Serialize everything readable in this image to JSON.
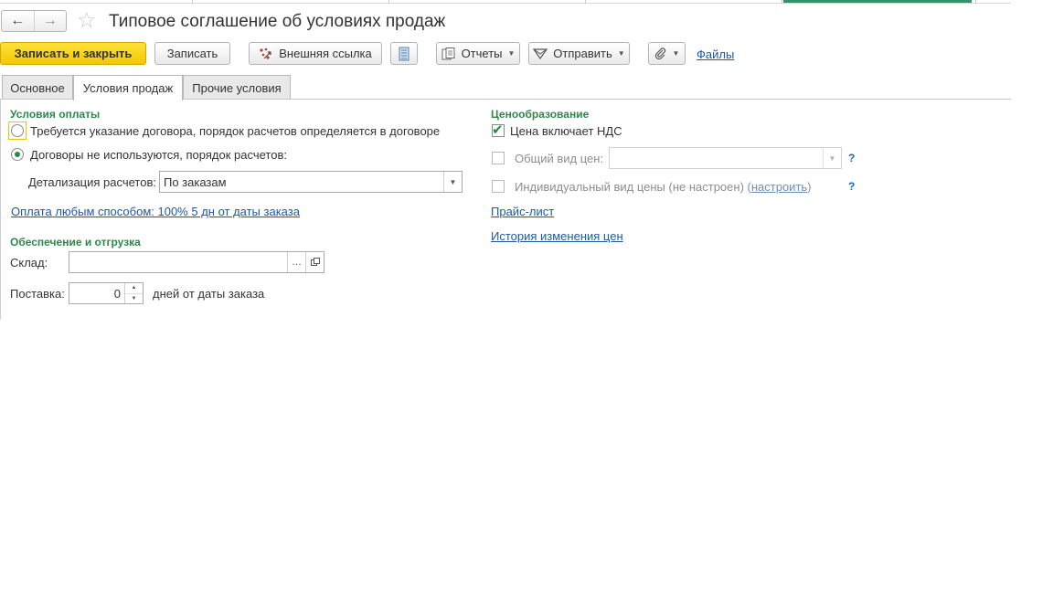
{
  "window": {
    "title": "Типовое соглашение об условиях продаж",
    "nav_back_icon": "arrow-left-icon",
    "nav_forward_icon": "arrow-right-icon",
    "favorite_icon": "star-icon"
  },
  "toolbar": {
    "save_close_label": "Записать и закрыть",
    "save_label": "Записать",
    "external_link_label": "Внешняя ссылка",
    "reports_label": "Отчеты",
    "send_label": "Отправить",
    "files_label": "Файлы"
  },
  "tabs": [
    {
      "label": "Основное"
    },
    {
      "label": "Условия продаж"
    },
    {
      "label": "Прочие условия"
    }
  ],
  "payment": {
    "group_title": "Условия оплаты",
    "option_contract_label": "Требуется указание договора, порядок расчетов определяется в договоре",
    "option_no_contract_label": "Договоры не используются, порядок расчетов:",
    "detail_label": "Детализация расчетов:",
    "detail_value": "По заказам",
    "payment_link": "Оплата любым способом: 100% 5 дн от даты заказа"
  },
  "supply": {
    "group_title": "Обеспечение и отгрузка",
    "warehouse_label": "Склад:",
    "warehouse_value": "",
    "delivery_label": "Поставка:",
    "delivery_value": "0",
    "delivery_suffix": "дней от даты заказа"
  },
  "pricing": {
    "group_title": "Ценообразование",
    "vat_label": "Цена включает НДС",
    "general_price_label": "Общий вид цен:",
    "general_price_value": "",
    "individual_price_label": "Индивидуальный вид цены (не настроен) (",
    "configure_link": "настроить",
    "individual_price_close": ")",
    "help": "?",
    "price_list_link": "Прайс-лист",
    "price_history_link": "История изменения цен"
  },
  "colors": {
    "primary_button": "#f3c800",
    "group_title": "#2b8a4a",
    "link": "#1a5aa6"
  }
}
